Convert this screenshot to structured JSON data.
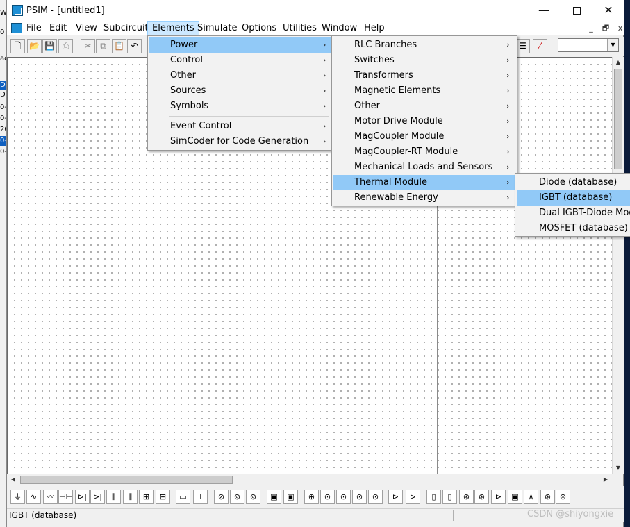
{
  "window": {
    "app_name": "PSIM",
    "title": "PSIM - [untitled1]",
    "minimize_glyph": "—",
    "close_glyph": "✕"
  },
  "menubar": {
    "items": [
      "File",
      "Edit",
      "View",
      "Subcircuit",
      "Elements",
      "Simulate",
      "Options",
      "Utilities",
      "Window",
      "Help"
    ],
    "active": "Elements",
    "mdi_controls": [
      "_",
      "🗗",
      "x"
    ]
  },
  "elements_menu": {
    "groups": [
      [
        "Power",
        "Control",
        "Other",
        "Sources",
        "Symbols"
      ],
      [
        "Event Control",
        "SimCoder for Code Generation"
      ]
    ],
    "highlighted": "Power"
  },
  "power_submenu": {
    "items": [
      "RLC Branches",
      "Switches",
      "Transformers",
      "Magnetic Elements",
      "Other",
      "Motor Drive Module",
      "MagCoupler Module",
      "MagCoupler-RT Module",
      "Mechanical Loads and Sensors",
      "Thermal Module",
      "Renewable Energy"
    ],
    "highlighted": "Thermal Module"
  },
  "thermal_submenu": {
    "items": [
      "Diode (database)",
      "IGBT (database)",
      "Dual IGBT-Diode Module",
      "MOSFET (database)"
    ],
    "highlighted": "IGBT (database)"
  },
  "toolbar": {
    "icons": [
      "new-file-icon",
      "open-folder-icon",
      "save-icon",
      "print-icon",
      "cut-icon",
      "copy-icon",
      "paste-icon",
      "undo-icon"
    ],
    "right_icons": [
      "list-icon",
      "wire-icon"
    ],
    "zoom_combo_value": ""
  },
  "status": {
    "text": "IGBT (database)"
  },
  "watermark": {
    "text": "CSDN @shiyongxie"
  },
  "left_window_fragments": [
    "W",
    "0",
    "ac",
    "D",
    "Dc",
    "0-",
    "0-",
    "20",
    "0-",
    "0-"
  ],
  "arrow_glyph": "›",
  "colors": {
    "menu_highlight": "#91c9f7",
    "menubar_active": "#cce8ff",
    "canvas_dot": "#9a9a9a"
  }
}
